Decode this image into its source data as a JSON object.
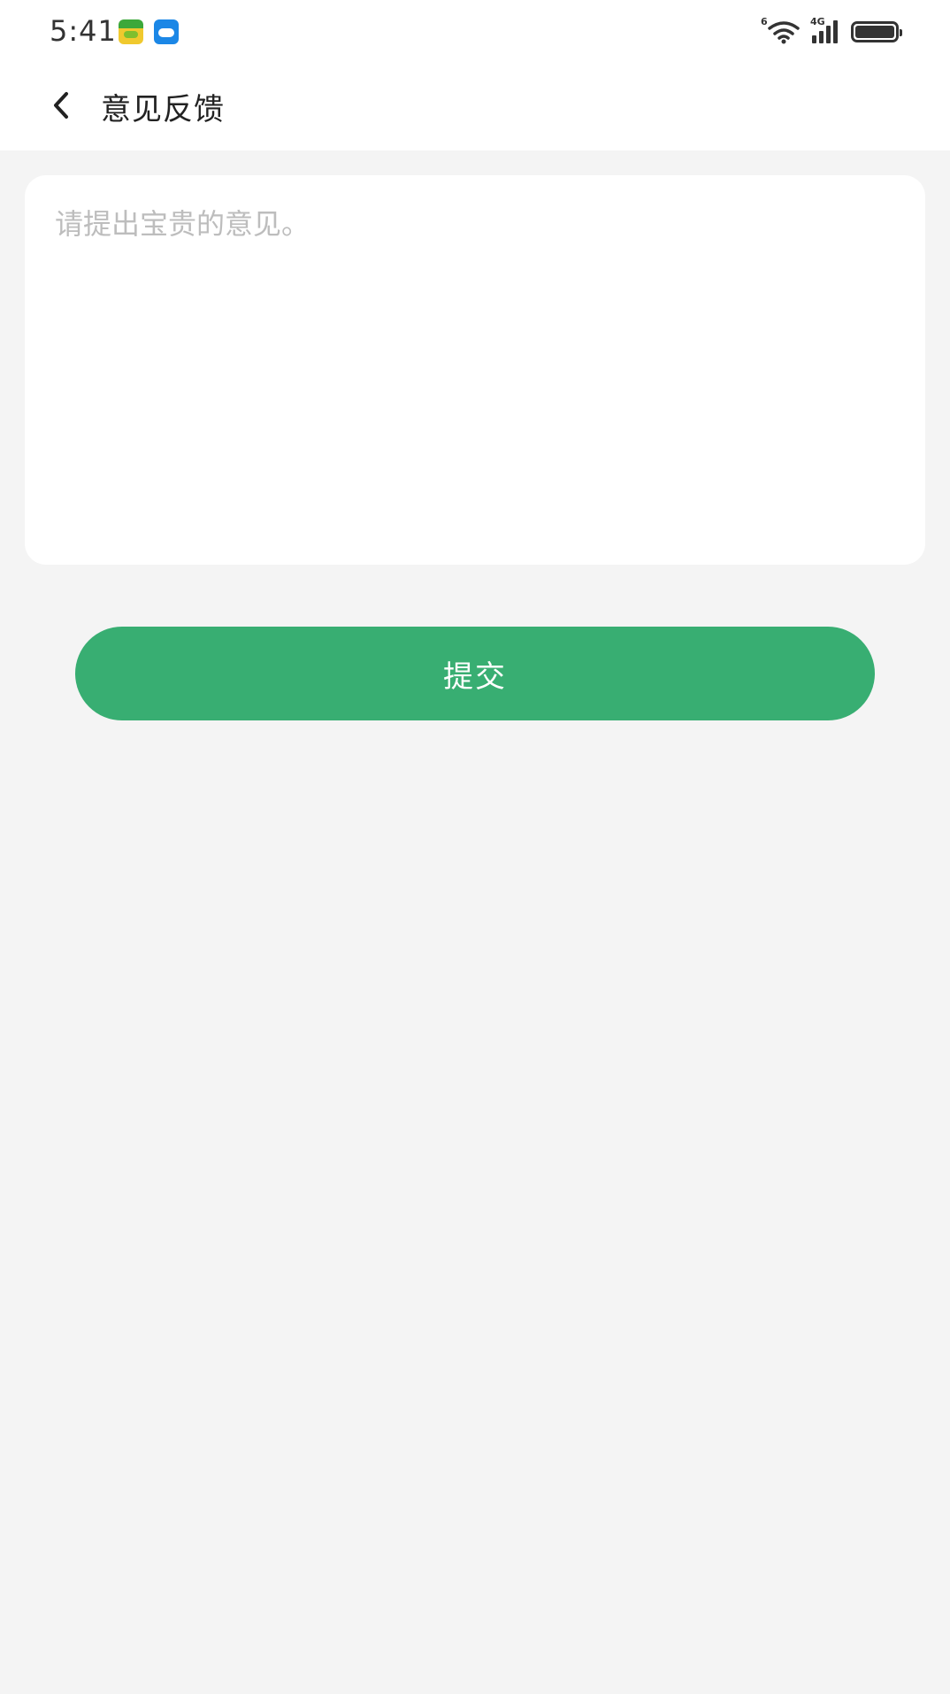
{
  "status_bar": {
    "time": "5:41",
    "notification_icons": [
      "game-app-icon",
      "weather-app-icon"
    ],
    "wifi_label": "6",
    "network_label": "4G"
  },
  "header": {
    "title": "意见反馈",
    "back_icon": "chevron-left-icon"
  },
  "feedback": {
    "value": "",
    "placeholder": "请提出宝贵的意见。"
  },
  "submit": {
    "label": "提交"
  },
  "colors": {
    "accent": "#38ae72",
    "background": "#f4f4f4",
    "card": "#ffffff",
    "placeholder": "#bdbdbd"
  }
}
